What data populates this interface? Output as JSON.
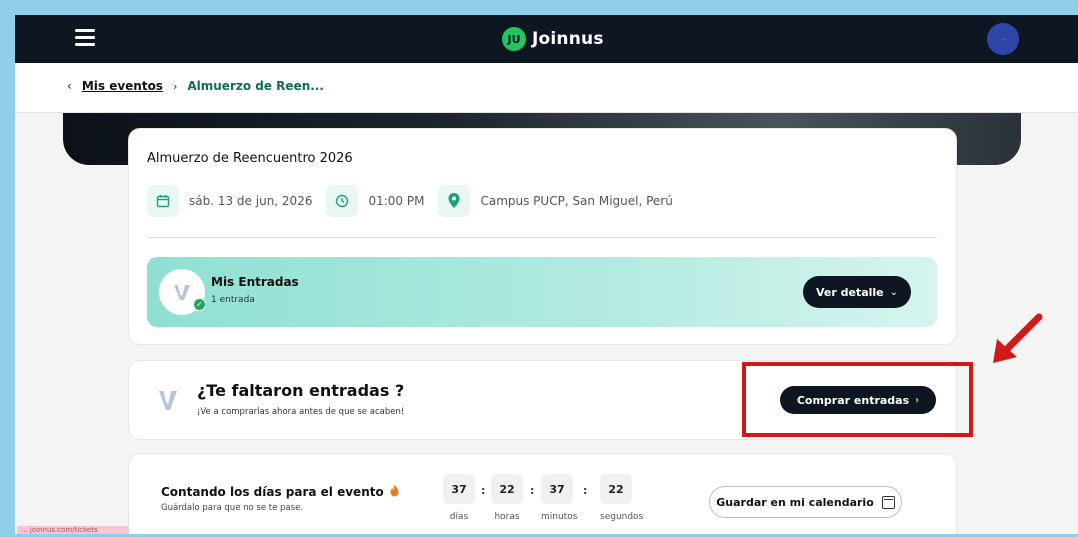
{
  "nav": {
    "logo_mark": "JU",
    "logo_text": "Joinnus",
    "avatar_text": "⋯"
  },
  "breadcrumb": {
    "back_glyph": "‹",
    "parent": "Mis eventos",
    "separator": "›",
    "current": "Almuerzo de Reen..."
  },
  "event": {
    "title": "Almuerzo de Reencuentro 2026",
    "date": "sáb. 13 de jun, 2026",
    "time": "01:00 PM",
    "location": "Campus PUCP, San Miguel, Perú"
  },
  "tickets": {
    "title": "Mis Entradas",
    "count": "1 entrada",
    "detail_button": "Ver detalle",
    "detail_chevron": "⌄"
  },
  "buy": {
    "title": "¿Te faltaron entradas ?",
    "subtitle": "¡Ve a comprarlas ahora antes de que se acaben!",
    "button": "Comprar entradas",
    "button_chevron": "›"
  },
  "countdown": {
    "title": "Contando los días para el evento",
    "subtitle": "Guárdalo para que no se te pase.",
    "days": "37",
    "days_label": "días",
    "hours": "22",
    "hours_label": "horas",
    "minutes": "37",
    "minutes_label": "minutos",
    "seconds": "22",
    "seconds_label": "segundos",
    "calendar_button": "Guardar en mi calendario"
  },
  "toast": {
    "text": "... joinnus.com/tickets"
  },
  "colors": {
    "nav_bg": "#0e1621",
    "accent_green": "#18a37a",
    "highlight_red": "#d01919",
    "tickets_gradient_start": "#8fe0d2"
  }
}
